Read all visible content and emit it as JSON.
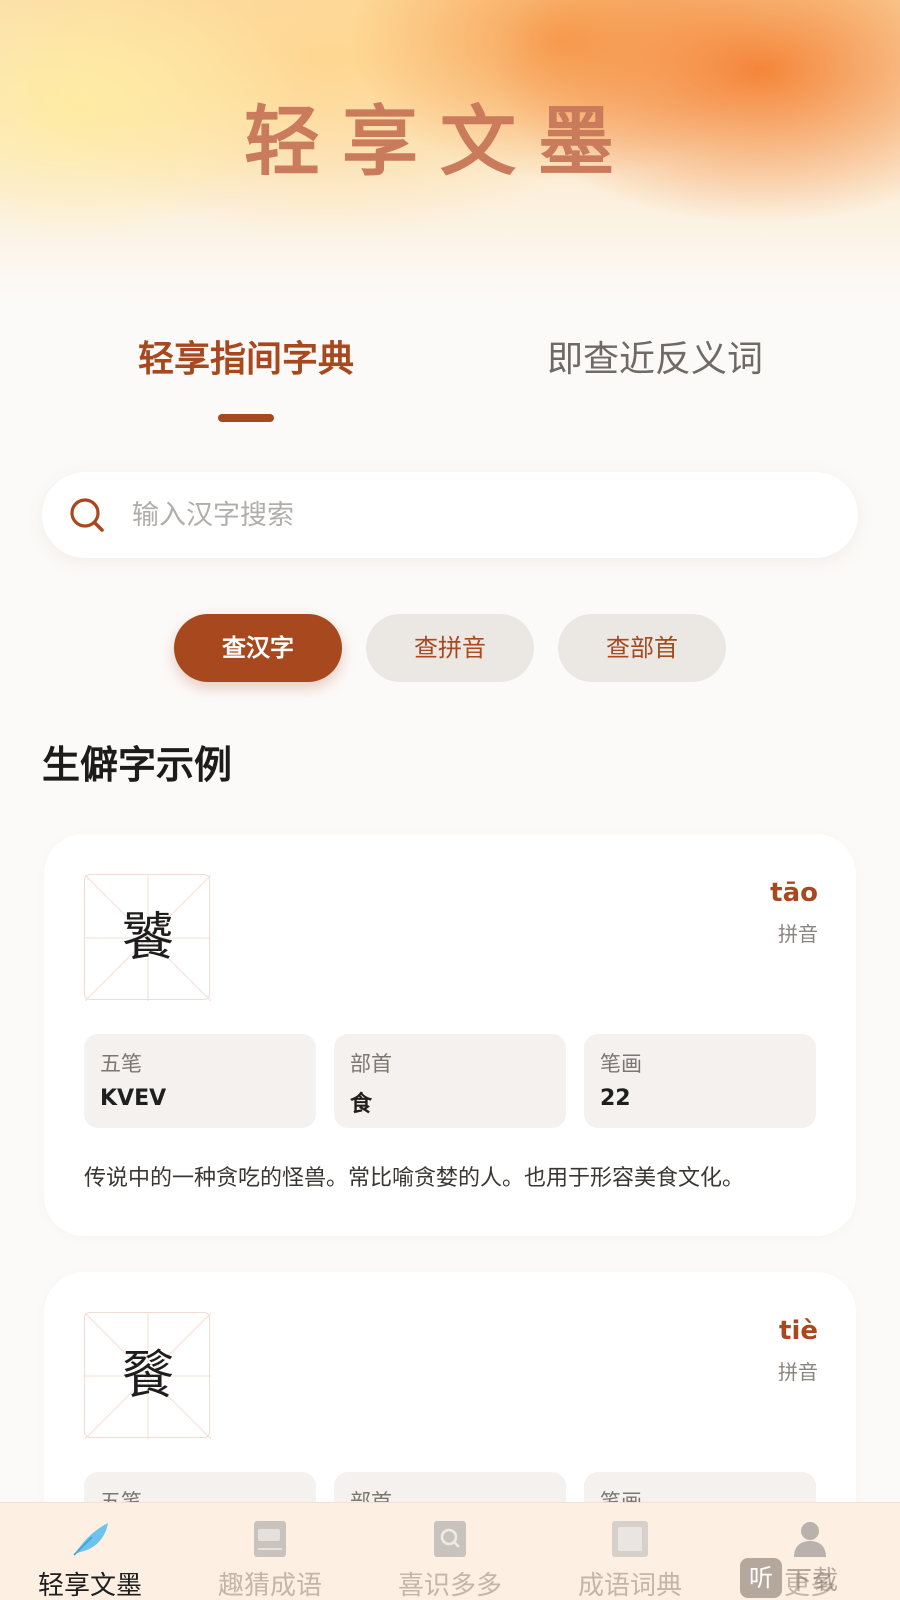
{
  "app": {
    "title": "轻享文墨"
  },
  "tabs": [
    {
      "label": "轻享指间字典",
      "active": true
    },
    {
      "label": "即查近反义词",
      "active": false
    }
  ],
  "search": {
    "placeholder": "输入汉字搜索",
    "icon": "search-icon"
  },
  "filters": [
    {
      "label": "查汉字",
      "active": true
    },
    {
      "label": "查拼音",
      "active": false
    },
    {
      "label": "查部首",
      "active": false
    }
  ],
  "section": {
    "title": "生僻字示例"
  },
  "cards": [
    {
      "char": "饕",
      "pinyin": "tāo",
      "pinyin_label": "拼音",
      "fields": [
        {
          "label": "五笔",
          "value": "KVEV"
        },
        {
          "label": "部首",
          "value": "食"
        },
        {
          "label": "笔画",
          "value": "22"
        }
      ],
      "description": "传说中的一种贪吃的怪兽。常比喻贪婪的人。也用于形容美食文化。"
    },
    {
      "char": "餮",
      "pinyin": "tiè",
      "pinyin_label": "拼音",
      "fields": [
        {
          "label": "五笔",
          "value": ""
        },
        {
          "label": "部首",
          "value": ""
        },
        {
          "label": "笔画",
          "value": ""
        }
      ],
      "description": ""
    }
  ],
  "bottom_nav": [
    {
      "label": "轻享文墨",
      "icon": "feather-icon",
      "active": true
    },
    {
      "label": "趣猜成语",
      "icon": "book-icon",
      "active": false
    },
    {
      "label": "喜识多多",
      "icon": "search-book-icon",
      "active": false
    },
    {
      "label": "成语词典",
      "icon": "dictionary-icon",
      "active": false
    },
    {
      "label": "更多",
      "icon": "user-icon",
      "active": false
    }
  ],
  "watermark": {
    "badge": "听",
    "text": "下载"
  },
  "colors": {
    "accent": "#a8481f",
    "title": "#c97b5c",
    "pill_bg": "#ebe7e3",
    "nav_bg": "#fdf0e3"
  }
}
